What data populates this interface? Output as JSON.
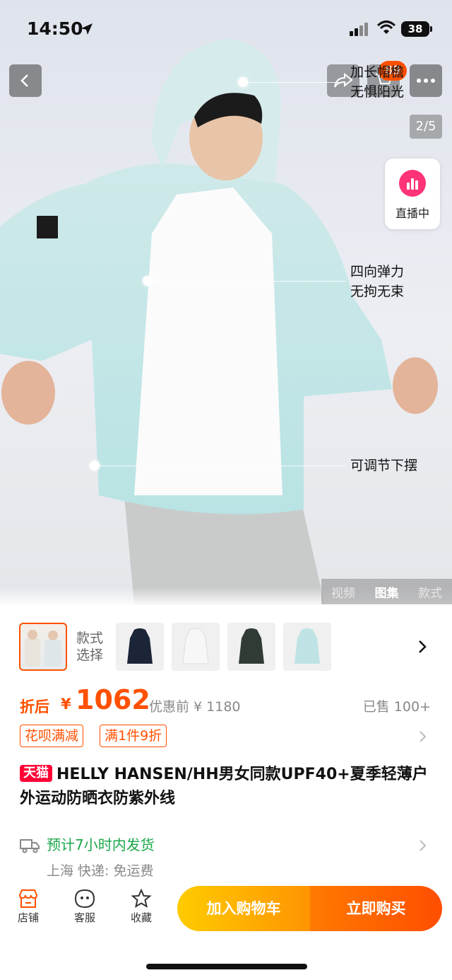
{
  "status_bar": {
    "time": "14:50",
    "battery": "38"
  },
  "header": {
    "cart_count": "89",
    "page_indicator": "2/5",
    "live_label": "直播中"
  },
  "annotations": [
    {
      "line1": "加长帽檐",
      "line2": "无惧阳光"
    },
    {
      "line1": "四向弹力",
      "line2": "无拘无束"
    },
    {
      "line1": "可调节下摆",
      "line2": ""
    }
  ],
  "media_tabs": [
    "视频",
    "图集",
    "款式"
  ],
  "media_tabs_active": "图集",
  "style_selector": {
    "label_line1": "款式",
    "label_line2": "选择"
  },
  "price": {
    "tag": "折后",
    "currency": "¥",
    "value": "1062",
    "original": "优惠前 ¥ 1180",
    "sold": "已售 100+"
  },
  "promos": [
    "花呗满减",
    "满1件9折"
  ],
  "product": {
    "badge": "天猫",
    "title": "HELLY HANSEN/HH男女同款UPF40+夏季轻薄户外运动防晒衣防紫外线"
  },
  "shipping": {
    "eta": "预计7小时内发货",
    "origin": "上海  快递: 免运费"
  },
  "bottom_bar": {
    "store": "店铺",
    "service": "客服",
    "favorite": "收藏",
    "add_to_cart": "加入购物车",
    "buy_now": "立即购买"
  },
  "colors": {
    "accent": "#ff5000",
    "green": "#1aa84a",
    "tmall": "#ff0036"
  }
}
